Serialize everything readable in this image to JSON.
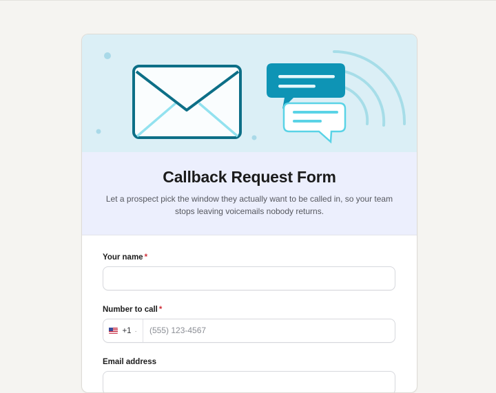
{
  "form": {
    "title": "Callback Request Form",
    "subtitle": "Let a prospect pick the window they actually want to be called in, so your team stops leaving voicemails nobody returns.",
    "required_marker": "*"
  },
  "fields": {
    "name": {
      "label": "Your name",
      "value": "",
      "required": true
    },
    "phone": {
      "label": "Number to call",
      "required": true,
      "country_flag": "us-flag-icon",
      "country_code": "+1",
      "separator": "·",
      "placeholder": "(555) 123-4567"
    },
    "email": {
      "label": "Email address"
    }
  },
  "colors": {
    "hero_bg": "#dbeff6",
    "header_bg": "#eceffd",
    "accent_teal": "#0e94b5",
    "accent_dark": "#0d6f87",
    "required_red": "#d0303a"
  },
  "illustration": {
    "icons": [
      "envelope-icon",
      "chat-bubbles-icon",
      "signal-waves-icon"
    ]
  }
}
